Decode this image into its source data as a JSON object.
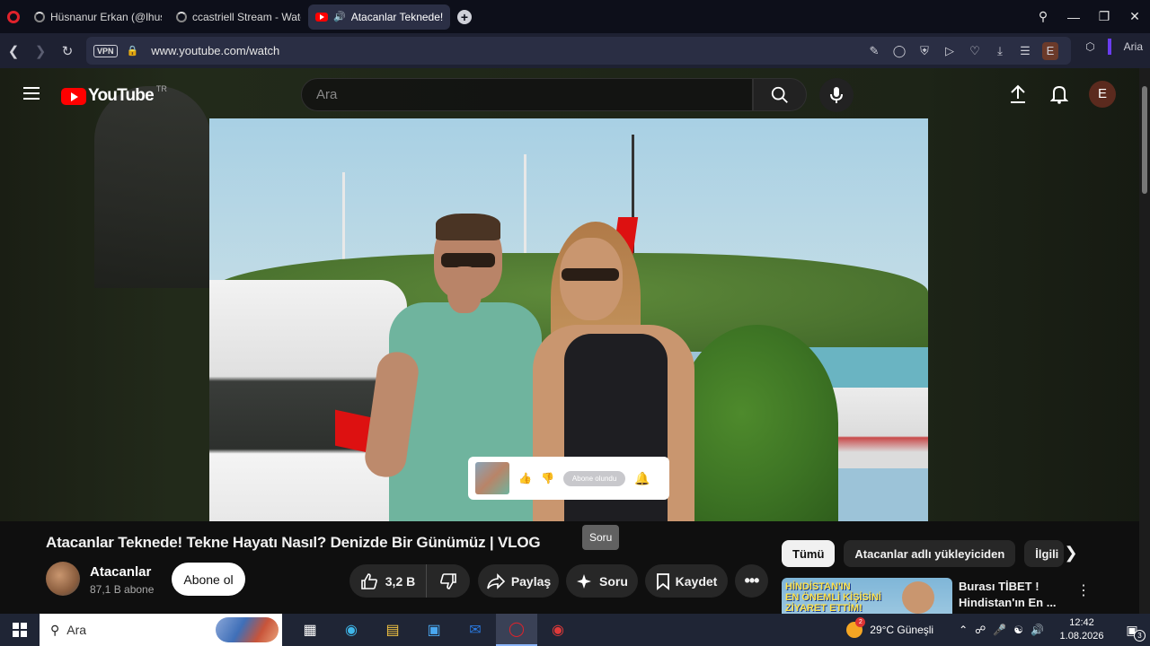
{
  "browser": {
    "tabs": [
      {
        "label": "Hüsnanur Erkan (@lhusna"
      },
      {
        "label": "ccastriell Stream - Watch"
      },
      {
        "label": "Atacanlar Teknede! Te"
      }
    ],
    "url": "www.youtube.com/watch",
    "vpn_label": "VPN",
    "profile_letter": "E",
    "aria_label": "Aria"
  },
  "youtube": {
    "logo_text": "YouTube",
    "logo_region": "TR",
    "search_placeholder": "Ara",
    "user_initial": "E",
    "video": {
      "subscribe_popup_label": "Abone olundu"
    },
    "title": "Atacanlar Teknede! Tekne Hayatı Nasıl? Denizde Bir Günümüz | VLOG",
    "tooltip": "Soru",
    "channel": {
      "name": "Atacanlar",
      "subscribers": "87,1 B abone",
      "subscribe_label": "Abone ol"
    },
    "actions": {
      "likes": "3,2 B",
      "share": "Paylaş",
      "ask": "Soru",
      "save": "Kaydet"
    },
    "chips": [
      "Tümü",
      "Atacanlar adlı yükleyiciden",
      "İlgili"
    ],
    "recommendation": {
      "thumb_text_1": "HİNDİSTAN'IN",
      "thumb_text_2": "EN ÖNEMLİ KİŞİSİNİ",
      "thumb_text_3": "ZİYARET ETTİM!",
      "title": "Burası TİBET ! Hindistan'ın En ..."
    }
  },
  "taskbar": {
    "search_placeholder": "Ara",
    "weather": "29°C  Güneşli",
    "weather_badge": "2",
    "time": "12:42",
    "date": "1.08.2026",
    "notification_count": "3"
  },
  "icons": [
    "opera-icon",
    "search-icon",
    "mic-icon",
    "upload-icon",
    "bell-icon",
    "like-icon",
    "dislike-icon",
    "share-icon",
    "sparkle-icon",
    "bookmark-icon",
    "more-icon",
    "windows-icon"
  ]
}
